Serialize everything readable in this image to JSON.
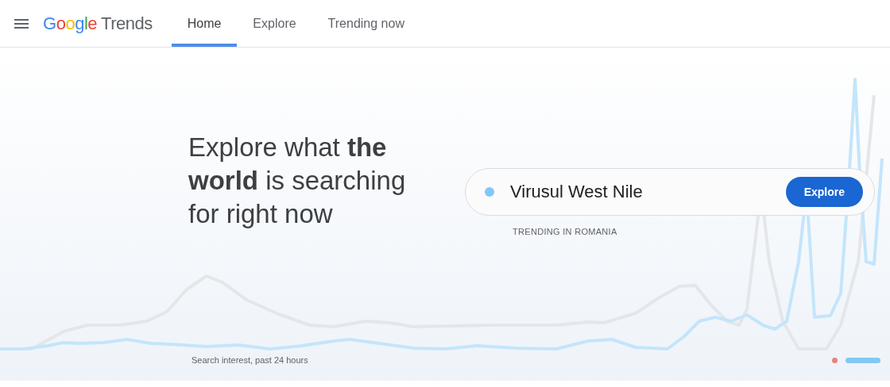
{
  "header": {
    "logo": {
      "brand": "Google",
      "product": "Trends"
    },
    "tabs": [
      {
        "label": "Home",
        "selected": true
      },
      {
        "label": "Explore",
        "selected": false
      },
      {
        "label": "Trending now",
        "selected": false
      }
    ]
  },
  "hero": {
    "headline": "Explore what **the world** is searching for right now",
    "search": {
      "value": "Virusul West Nile",
      "color": "#81c9f5",
      "button": "Explore",
      "caption": "TRENDING IN ROMANIA"
    },
    "chart_caption": "Search interest, past 24 hours",
    "carousel": [
      {
        "selected": false,
        "color": "#e8847a"
      },
      {
        "selected": true,
        "color": "#81c9f5"
      }
    ]
  }
}
